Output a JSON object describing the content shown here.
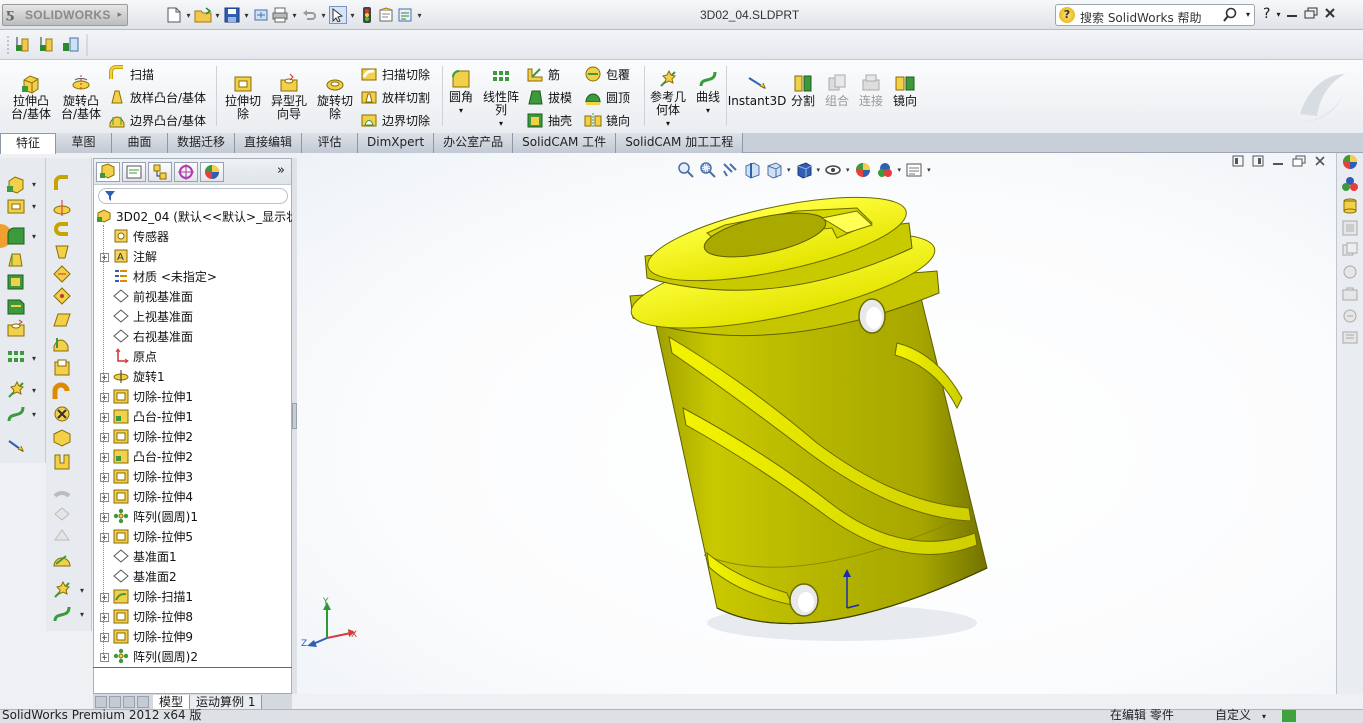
{
  "app": {
    "brand": "SOLIDWORKS",
    "document_title": "3D02_04.SLDPRT"
  },
  "search": {
    "placeholder": "搜索 SolidWorks 帮助"
  },
  "help": {
    "label": "?"
  },
  "command_manager": {
    "features": {
      "extrude_boss": "拉伸凸\n台/基体",
      "revolve_boss": "旋转凸\n台/基体",
      "sweep": "扫描",
      "loft": "放样凸台/基体",
      "boundary": "边界凸台/基体",
      "extrude_cut": "拉伸切\n除",
      "hole_wizard": "异型孔\n向导",
      "revolve_cut": "旋转切\n除",
      "swept_cut": "扫描切除",
      "lofted_cut": "放样切割",
      "boundary_cut": "边界切除",
      "fillet": "圆角",
      "linear_pattern": "线性阵\n列",
      "rib": "筋",
      "draft": "拔模",
      "shell": "抽壳",
      "wrap": "包覆",
      "dome": "圆顶",
      "mirror": "镜向",
      "ref_geometry": "参考几\n何体",
      "curves": "曲线",
      "instant3d": "Instant3D",
      "split": "分割",
      "combine": "组合",
      "join": "连接",
      "mirror2": "镜向"
    }
  },
  "tabs": [
    {
      "label": "特征",
      "active": true
    },
    {
      "label": "草图"
    },
    {
      "label": "曲面"
    },
    {
      "label": "数据迁移"
    },
    {
      "label": "直接编辑"
    },
    {
      "label": "评估"
    },
    {
      "label": "DimXpert"
    },
    {
      "label": "办公室产品"
    },
    {
      "label": "SolidCAM 工件"
    },
    {
      "label": "SolidCAM 加工工程"
    }
  ],
  "feature_tree": {
    "root": "3D02_04 (默认<<默认>_显示状",
    "nodes": [
      {
        "label": "传感器",
        "icon": "sensor-icon",
        "expand": false
      },
      {
        "label": "注解",
        "icon": "annotation-icon",
        "expand": true
      },
      {
        "label": "材质 <未指定>",
        "icon": "material-icon",
        "expand": false
      },
      {
        "label": "前视基准面",
        "icon": "plane-icon",
        "expand": false
      },
      {
        "label": "上视基准面",
        "icon": "plane-icon",
        "expand": false
      },
      {
        "label": "右视基准面",
        "icon": "plane-icon",
        "expand": false
      },
      {
        "label": "原点",
        "icon": "origin-icon",
        "expand": false
      },
      {
        "label": "旋转1",
        "icon": "revolve-icon",
        "expand": true
      },
      {
        "label": "切除-拉伸1",
        "icon": "cut-extrude-icon",
        "expand": true
      },
      {
        "label": "凸台-拉伸1",
        "icon": "boss-extrude-icon",
        "expand": true
      },
      {
        "label": "切除-拉伸2",
        "icon": "cut-extrude-icon",
        "expand": true
      },
      {
        "label": "凸台-拉伸2",
        "icon": "boss-extrude-icon",
        "expand": true
      },
      {
        "label": "切除-拉伸3",
        "icon": "cut-extrude-icon",
        "expand": true
      },
      {
        "label": "切除-拉伸4",
        "icon": "cut-extrude-icon",
        "expand": true
      },
      {
        "label": "阵列(圆周)1",
        "icon": "circular-pattern-icon",
        "expand": true
      },
      {
        "label": "切除-拉伸5",
        "icon": "cut-extrude-icon",
        "expand": true
      },
      {
        "label": "基准面1",
        "icon": "plane-icon",
        "expand": false
      },
      {
        "label": "基准面2",
        "icon": "plane-icon",
        "expand": false
      },
      {
        "label": "切除-扫描1",
        "icon": "cut-sweep-icon",
        "expand": true
      },
      {
        "label": "切除-拉伸8",
        "icon": "cut-extrude-icon",
        "expand": true
      },
      {
        "label": "切除-拉伸9",
        "icon": "cut-extrude-icon",
        "expand": true
      },
      {
        "label": "阵列(圆周)2",
        "icon": "circular-pattern-icon",
        "expand": true
      }
    ],
    "bottom_tabs": [
      "模型",
      "运动算例 1"
    ]
  },
  "triad": {
    "x": "X",
    "y": "Y",
    "z": "Z"
  },
  "status": {
    "product": "SolidWorks Premium 2012 x64 版",
    "mode": "在编辑 零件",
    "units": "自定义"
  },
  "colors": {
    "part": "#d4d400",
    "accent": "#3b6fc4"
  }
}
